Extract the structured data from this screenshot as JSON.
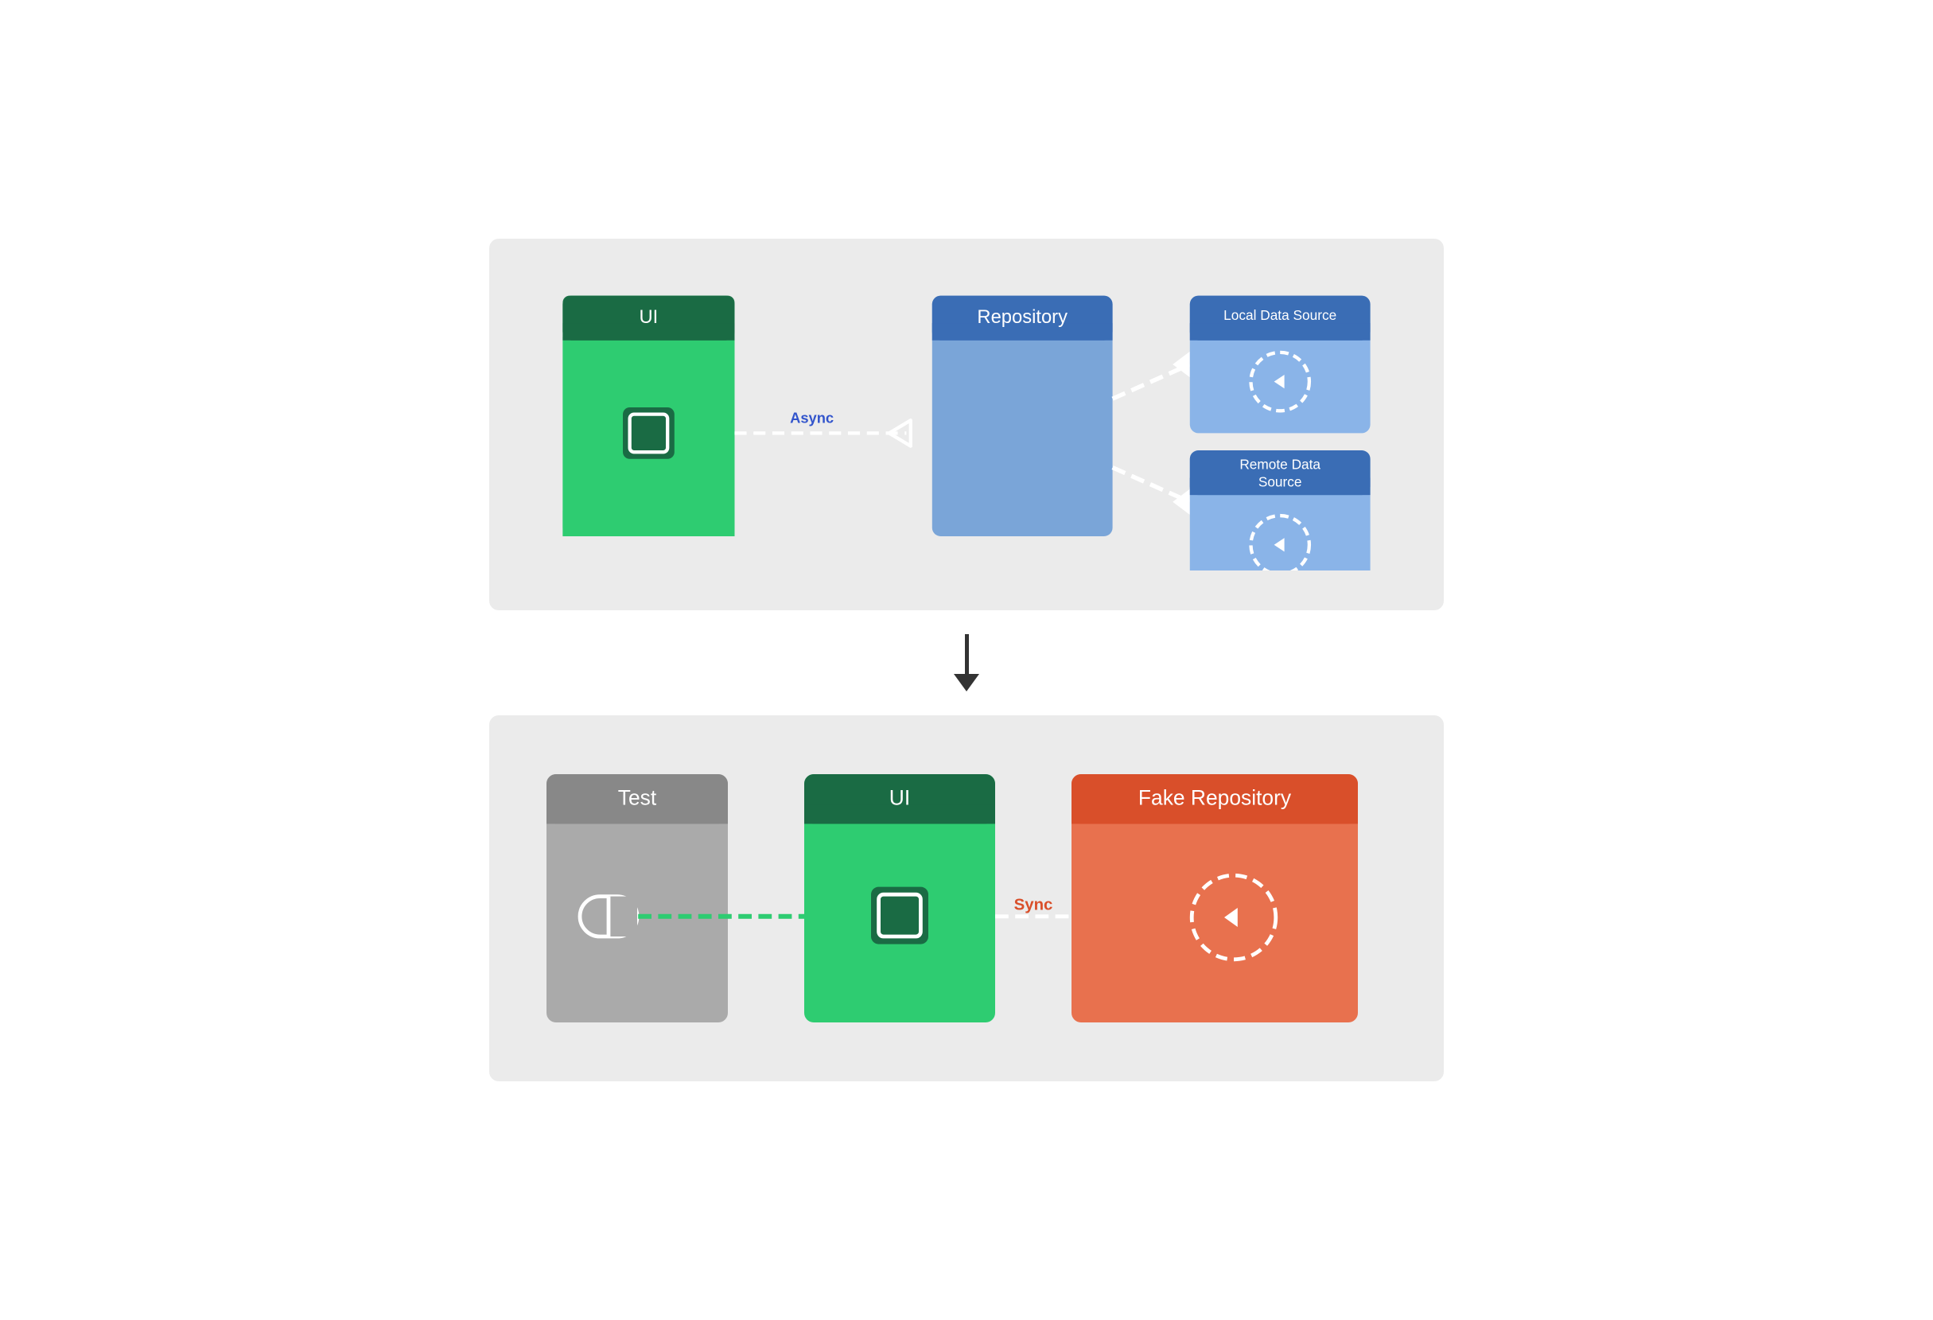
{
  "top_diagram": {
    "ui_label": "UI",
    "ui_header_color": "#1a6b44",
    "ui_body_color": "#2ecc71",
    "async_label": "Async",
    "repo_label": "Repository",
    "repo_header_color": "#3a6db5",
    "repo_body_color": "#7aa5d8",
    "local_ds_label": "Local Data Source",
    "remote_ds_label": "Remote Data Source",
    "ds_header_color": "#3a6db5",
    "ds_body_color": "#8ab4e8",
    "bg_color": "#e8e8e8"
  },
  "bottom_diagram": {
    "test_label": "Test",
    "test_header_color": "#888888",
    "test_body_color": "#aaaaaa",
    "ui_label": "UI",
    "ui_header_color": "#1a6b44",
    "ui_body_color": "#2ecc71",
    "sync_label": "Sync",
    "fake_repo_label": "Fake Repository",
    "fake_repo_header_color": "#d94f2a",
    "fake_repo_body_color": "#e8714e",
    "bg_color": "#e8e8e8"
  },
  "arrow": {
    "down_arrow_color": "#333333"
  }
}
